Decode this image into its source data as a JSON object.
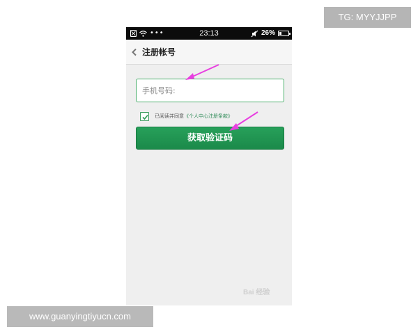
{
  "status_bar": {
    "time": "23:13",
    "dots": "•••",
    "battery_text": "26%",
    "battery_level": 0.26
  },
  "header": {
    "title": "注册帐号"
  },
  "form": {
    "phone_placeholder": "手机号码:",
    "agree_checked": true,
    "agree_prefix": "已阅读并同意",
    "agree_link": "《个人中心注册条款》",
    "get_code_label": "获取验证码"
  },
  "overlays": {
    "tag": "TG: MYYJJPP",
    "url": "www.guanyingtiyucn.com",
    "watermark": "Bai 经验"
  },
  "colors": {
    "accent_green": "#1f9653",
    "annotation_arrow": "#e83fe0",
    "status_bar_bg": "#0c0c0c",
    "page_bg": "#efefef"
  },
  "icons": [
    "close-box-icon",
    "wifi-icon",
    "mute-icon",
    "battery-icon",
    "back-chevron-icon",
    "checkmark-icon"
  ]
}
